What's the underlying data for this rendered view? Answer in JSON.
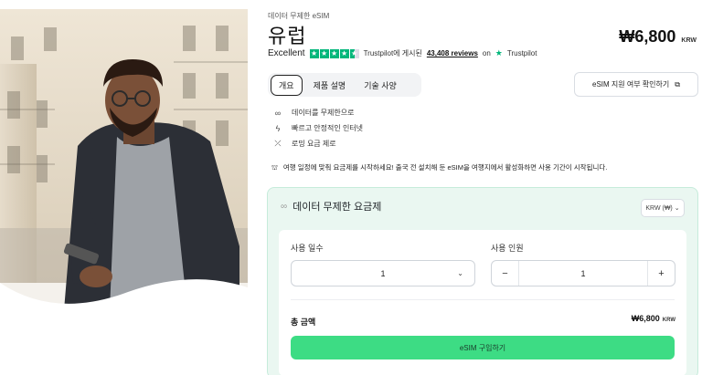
{
  "product": {
    "eyebrow": "데이터 무제한 eSIM",
    "title": "유럽",
    "price": "₩6,800",
    "currency": "KRW"
  },
  "rating": {
    "label": "Excellent",
    "stars": 4.5,
    "trustpilot_text": "Trustpilot에 게시된",
    "reviews": "43,408 reviews",
    "on_text": "on",
    "brand": "Trustpilot"
  },
  "tabs": [
    {
      "label": "개요",
      "active": true
    },
    {
      "label": "제품 설명",
      "active": false
    },
    {
      "label": "기술 사양",
      "active": false
    }
  ],
  "check_button": {
    "label": "eSIM 지원 여부 확인하기",
    "icon": "copy-icon"
  },
  "features": [
    {
      "icon": "infinity-icon",
      "label": "데이터를 무제한으로"
    },
    {
      "icon": "bolt-icon",
      "label": "빠르고 안정적인 인터넷"
    },
    {
      "icon": "no-roaming-icon",
      "label": "로밍 요금 제로"
    }
  ],
  "note": {
    "icon": "sim-activate-icon",
    "text": "여행 일정에 맞춰 요금제를 시작하세요! 출국 전 설치해 둔 eSIM을 여행지에서 활성화하면 사용 기간이 시작됩니다."
  },
  "plan": {
    "heading": "데이터 무제한 요금제",
    "currency_select": "KRW (₩)",
    "days_label": "사용 일수",
    "days_value": "1",
    "people_label": "사용 인원",
    "people_value": "1",
    "minus": "−",
    "plus": "+",
    "total_label": "총 금액",
    "total_amount": "₩6,800",
    "total_currency": "KRW",
    "buy_label": "eSIM 구입하기"
  },
  "colors": {
    "accent": "#3ddc84",
    "trustpilot": "#00b67a",
    "card_bg": "#eaf7f1"
  }
}
